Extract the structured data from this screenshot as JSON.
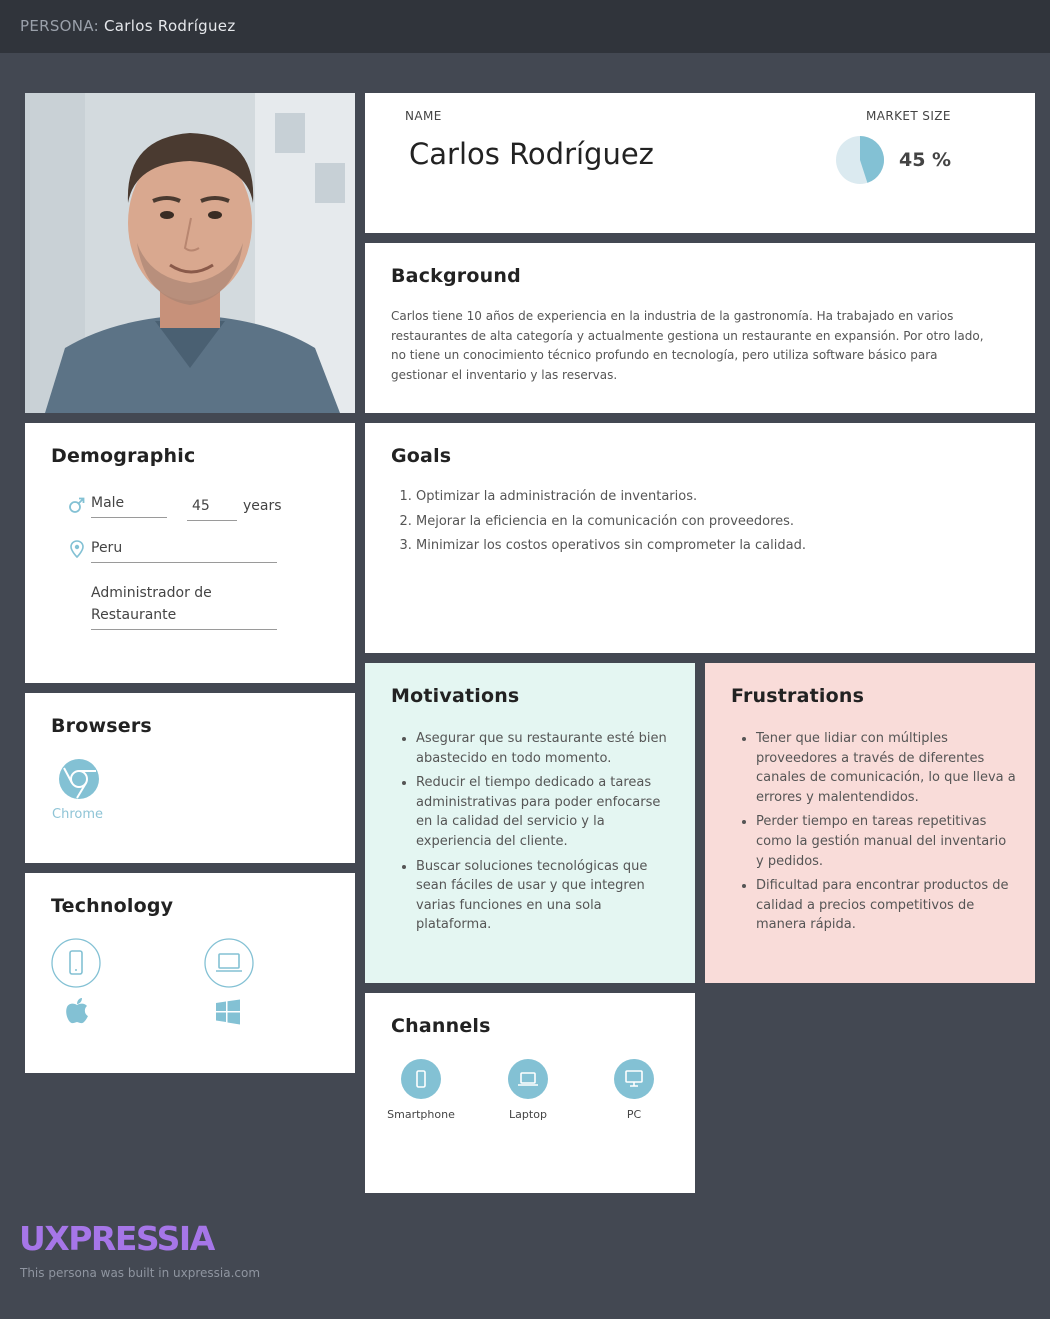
{
  "header": {
    "prefix": "PERSONA:",
    "name": "Carlos Rodríguez"
  },
  "profile": {
    "name_label": "NAME",
    "name": "Carlos Rodríguez",
    "market_size_label": "MARKET SIZE",
    "market_size_value": "45 %",
    "market_size_fraction": 0.45
  },
  "background": {
    "title": "Background",
    "text": "Carlos  tiene 10 años de experiencia en la industria de la gastronomía. Ha trabajado en varios restaurantes de alta categoría y actualmente gestiona un restaurante en expansión. Por otro lado,  no tiene un conocimiento técnico profundo en tecnología, pero utiliza software básico para gestionar el inventario y las reservas."
  },
  "demographic": {
    "title": "Demographic",
    "gender": "Male",
    "age": "45",
    "age_unit": "years",
    "location": "Peru",
    "occupation": "Administrador de Restaurante"
  },
  "goals": {
    "title": "Goals",
    "items": [
      "Optimizar la administración de inventarios.",
      "Mejorar la eficiencia en la comunicación con proveedores.",
      "Minimizar los costos operativos sin comprometer la calidad."
    ]
  },
  "browsers": {
    "title": "Browsers",
    "items": [
      {
        "label": "Chrome",
        "icon": "chrome-icon"
      }
    ]
  },
  "technology": {
    "title": "Technology",
    "devices": [
      {
        "icon": "smartphone-icon"
      },
      {
        "icon": "laptop-icon"
      }
    ],
    "os": [
      {
        "icon": "apple-icon"
      },
      {
        "icon": "windows-icon"
      }
    ]
  },
  "motivations": {
    "title": "Motivations",
    "items": [
      "Asegurar que su restaurante esté bien abastecido en todo momento.",
      "Reducir el tiempo dedicado a tareas administrativas para poder enfocarse en la calidad del servicio y la experiencia del cliente.",
      "Buscar soluciones tecnológicas que sean fáciles de usar y que integren varias funciones en una sola plataforma."
    ]
  },
  "frustrations": {
    "title": "Frustrations",
    "items": [
      "Tener que lidiar con múltiples proveedores a través de diferentes canales de comunicación, lo que lleva a errores y malentendidos.",
      "Perder tiempo en tareas repetitivas como la gestión manual del inventario y pedidos.",
      "Dificultad para encontrar productos de calidad a precios competitivos de manera rápida."
    ]
  },
  "channels": {
    "title": "Channels",
    "items": [
      {
        "label": "Smartphone",
        "icon": "smartphone-icon"
      },
      {
        "label": "Laptop",
        "icon": "laptop-icon"
      },
      {
        "label": "PC",
        "icon": "pc-icon"
      }
    ]
  },
  "footer": {
    "logo": "UXPRESSIA",
    "note": "This persona was built in uxpressia.com"
  },
  "colors": {
    "accent": "#83c1d4",
    "motivations_bg": "#e4f6f2",
    "frustrations_bg": "#f9dcd9",
    "logo": "#a676e8",
    "page_bg": "#434852",
    "header_bg": "#30343b"
  }
}
